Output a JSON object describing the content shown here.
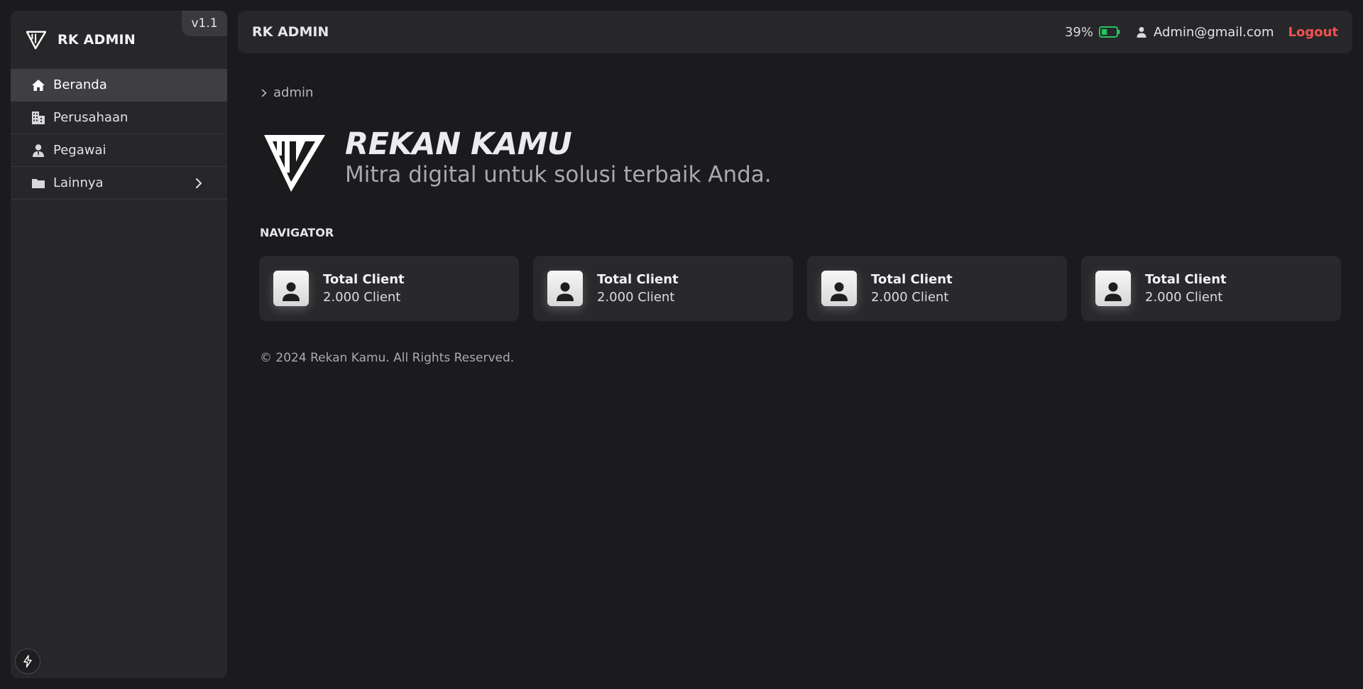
{
  "sidebar": {
    "brand": "RK ADMIN",
    "version": "v1.1",
    "items": [
      {
        "label": "Beranda",
        "icon": "home-icon"
      },
      {
        "label": "Perusahaan",
        "icon": "building-icon"
      },
      {
        "label": "Pegawai",
        "icon": "employee-icon"
      },
      {
        "label": "Lainnya",
        "icon": "folder-icon"
      }
    ],
    "bottom_icon": "bolt-icon"
  },
  "topbar": {
    "title": "RK ADMIN",
    "battery_percent": "39%",
    "battery_level": 0.39,
    "email": "Admin@gmail.com",
    "logout_label": "Logout"
  },
  "breadcrumb": {
    "item": "admin"
  },
  "hero": {
    "heading": "REKAN KAMU",
    "tagline": "Mitra digital untuk solusi terbaik Anda."
  },
  "navigator": {
    "title": "NAVIGATOR",
    "cards": [
      {
        "title": "Total Client",
        "value": "2.000 Client"
      },
      {
        "title": "Total Client",
        "value": "2.000 Client"
      },
      {
        "title": "Total Client",
        "value": "2.000 Client"
      },
      {
        "title": "Total Client",
        "value": "2.000 Client"
      }
    ]
  },
  "footer": "© 2024 Rekan Kamu. All Rights Reserved.",
  "colors": {
    "background": "#1b1b1d",
    "panel": "#27272a",
    "active_item": "#3e3e43",
    "logout": "#ef5350",
    "battery": "#22c55e"
  }
}
